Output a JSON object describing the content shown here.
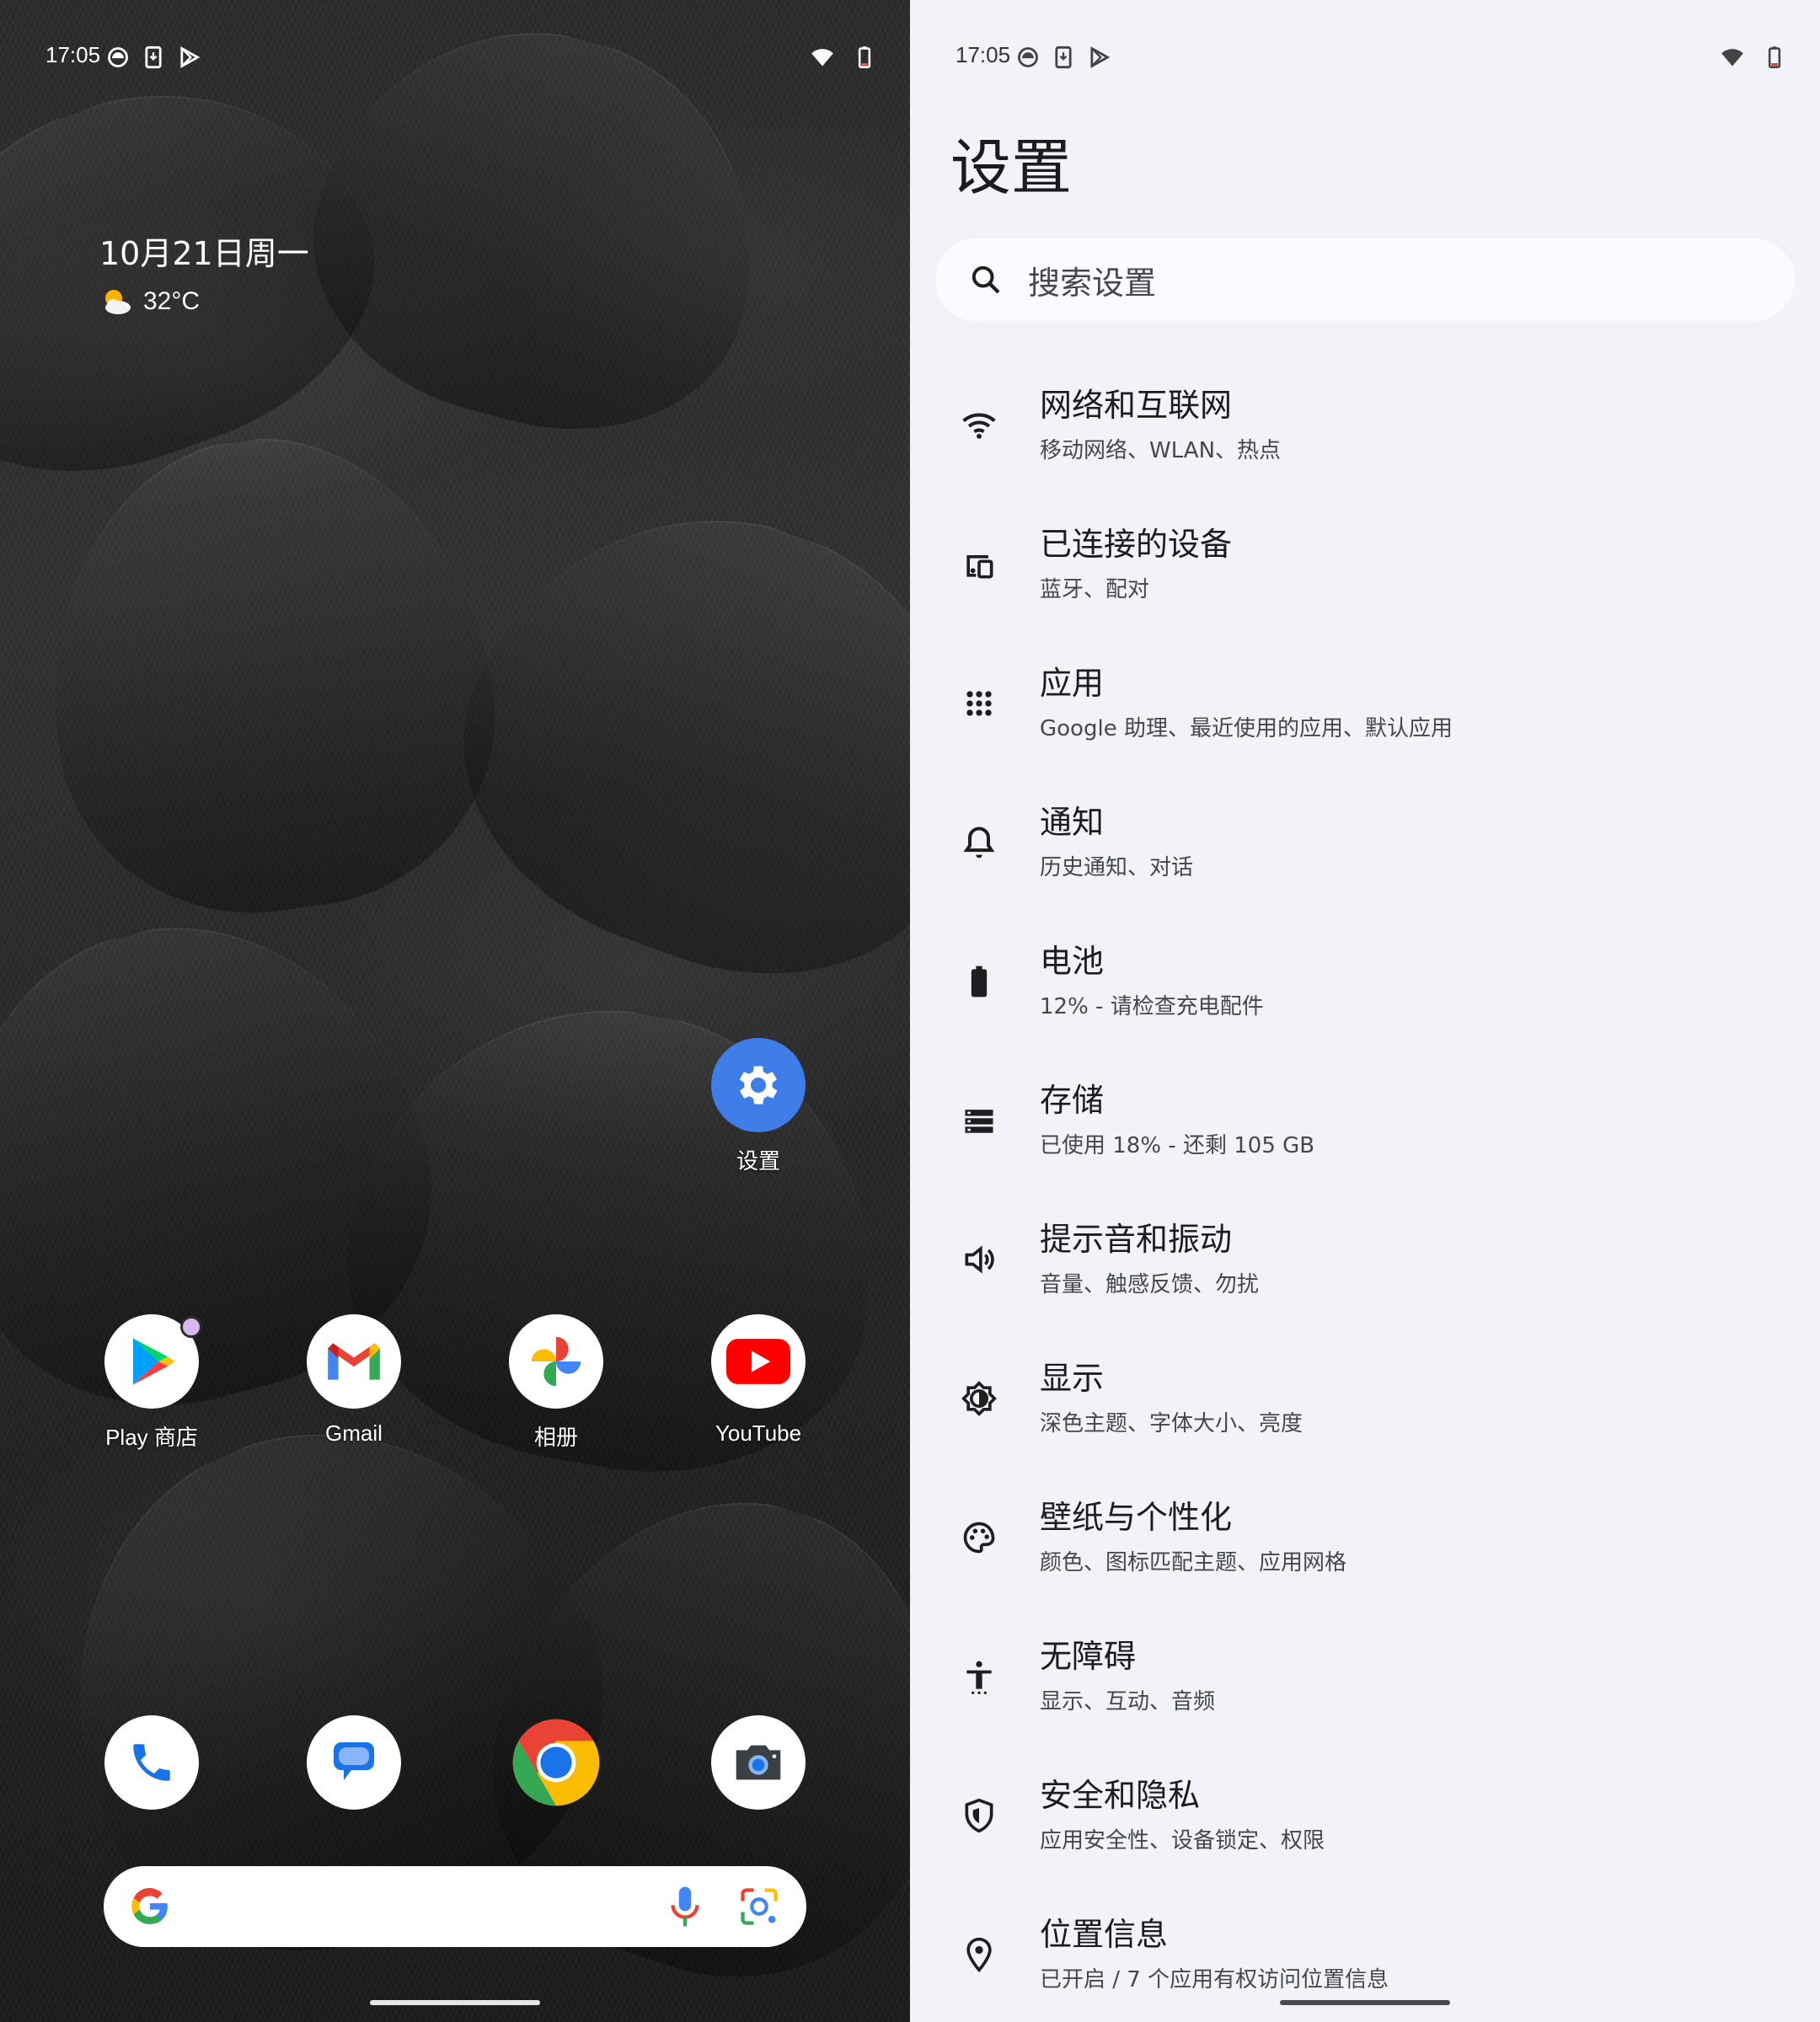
{
  "home": {
    "status_time": "17:05",
    "date": "10月21日周一",
    "temperature": "32°C",
    "apps_row1": [
      {
        "label": "Play 商店",
        "icon": "play-store-icon"
      },
      {
        "label": "Gmail",
        "icon": "gmail-icon"
      },
      {
        "label": "相册",
        "icon": "photos-icon"
      },
      {
        "label": "YouTube",
        "icon": "youtube-icon"
      }
    ],
    "settings_app_label": "设置",
    "dock": [
      {
        "icon": "phone-icon"
      },
      {
        "icon": "messages-icon"
      },
      {
        "icon": "chrome-icon"
      },
      {
        "icon": "camera-icon"
      }
    ]
  },
  "settings": {
    "status_time": "17:05",
    "title": "设置",
    "search_placeholder": "搜索设置",
    "items": [
      {
        "title": "网络和互联网",
        "subtitle": "移动网络、WLAN、热点",
        "icon": "wifi-icon"
      },
      {
        "title": "已连接的设备",
        "subtitle": "蓝牙、配对",
        "icon": "devices-icon"
      },
      {
        "title": "应用",
        "subtitle": "Google 助理、最近使用的应用、默认应用",
        "icon": "apps-icon"
      },
      {
        "title": "通知",
        "subtitle": "历史通知、对话",
        "icon": "bell-icon"
      },
      {
        "title": "电池",
        "subtitle": "12% - 请检查充电配件",
        "icon": "battery-icon"
      },
      {
        "title": "存储",
        "subtitle": "已使用 18% - 还剩 105 GB",
        "icon": "storage-icon"
      },
      {
        "title": "提示音和振动",
        "subtitle": "音量、触感反馈、勿扰",
        "icon": "volume-icon"
      },
      {
        "title": "显示",
        "subtitle": "深色主题、字体大小、亮度",
        "icon": "brightness-icon"
      },
      {
        "title": "壁纸与个性化",
        "subtitle": "颜色、图标匹配主题、应用网格",
        "icon": "palette-icon"
      },
      {
        "title": "无障碍",
        "subtitle": "显示、互动、音频",
        "icon": "accessibility-icon"
      },
      {
        "title": "安全和隐私",
        "subtitle": "应用安全性、设备锁定、权限",
        "icon": "shield-icon"
      },
      {
        "title": "位置信息",
        "subtitle": "已开启 / 7 个应用有权访问位置信息",
        "icon": "location-icon"
      }
    ]
  },
  "colors": {
    "settings_bg": "#f2f3f8",
    "accent_blue": "#4285f4",
    "settings_icon_bg": "#3f7de8"
  }
}
